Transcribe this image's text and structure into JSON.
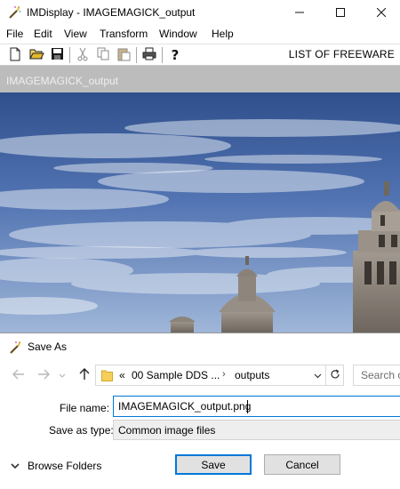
{
  "window": {
    "title": "IMDisplay - IMAGEMAGICK_output",
    "icons": [
      "magic-wand-icon",
      "minimize-icon",
      "maximize-icon",
      "close-icon"
    ]
  },
  "menu": {
    "items": [
      "File",
      "Edit",
      "View",
      "Transform",
      "Window",
      "Help"
    ]
  },
  "toolbar": {
    "buttons": [
      "new-file-icon",
      "open-folder-icon",
      "save-disk-icon",
      "cut-icon",
      "copy-icon",
      "paste-icon",
      "print-icon",
      "help-question-icon"
    ],
    "right_text": "LIST OF FREEWARE"
  },
  "document": {
    "title": "IMAGEMAGICK_output"
  },
  "dialog": {
    "title": "Save As",
    "breadcrumb": {
      "overflow": "«",
      "items": [
        "00 Sample DDS ...",
        "outputs"
      ]
    },
    "search_placeholder": "Search o",
    "file_name_label": "File name:",
    "file_name_value": "IMAGEMAGICK_output.png",
    "save_as_type_label": "Save as type:",
    "save_as_type_value": "Common image files",
    "browse_folders_label": "Browse Folders",
    "save_label": "Save",
    "cancel_label": "Cancel"
  },
  "colors": {
    "accent": "#0078d7",
    "doc_title_bar": "#bcbcbc",
    "sky": "#4a6aa6"
  }
}
